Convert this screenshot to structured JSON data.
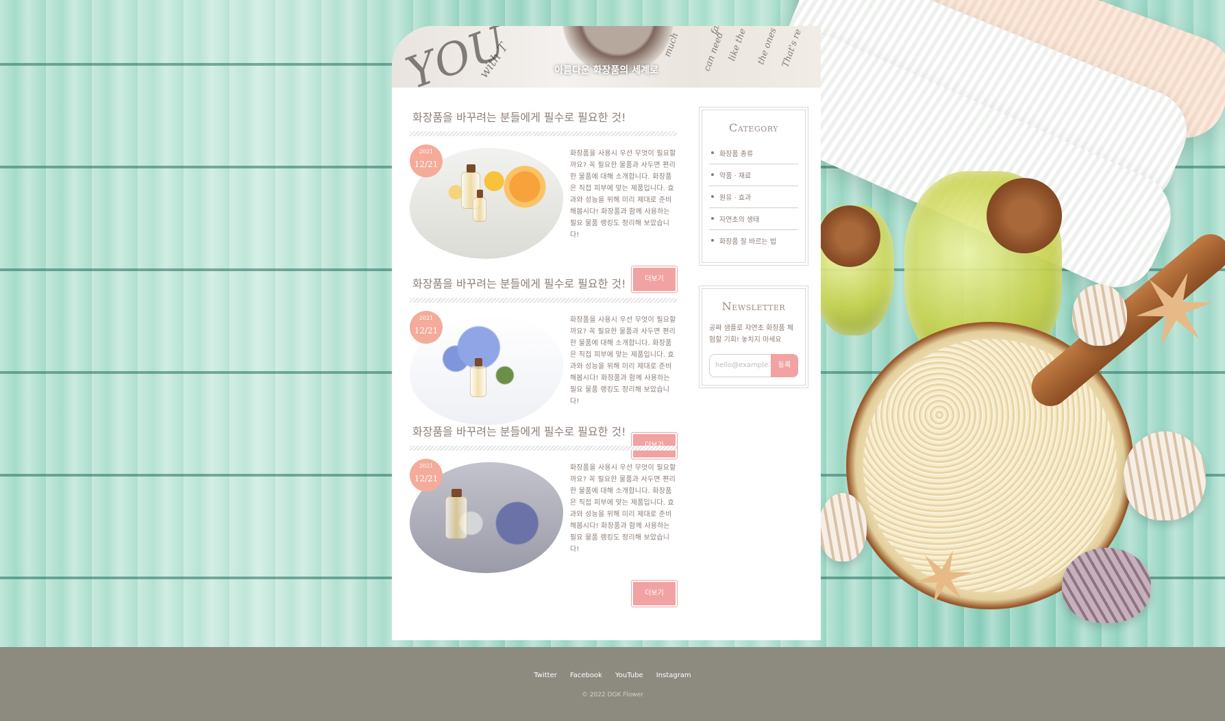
{
  "hero": {
    "title": "아름다운 화장품의 세계로",
    "decor_text": [
      "YOU",
      "with T",
      "can need",
      "like the",
      "the ones w",
      "fasci",
      "That's re",
      "much"
    ]
  },
  "posts": [
    {
      "title": "화장품을 바꾸려는 분들에게 필수로 필요한 것!",
      "date_year": "2021",
      "date_day": "12/21",
      "body": "화장품을 사용시 우선 무엇이 필요할까요? 꼭 필요한 물품과 사두면 편리한 물품에 대해 소개합니다. 화장품은 직접 피부에 맞는 제품입니다. 효과와 성능을 위해 미리 제대로 준비해봅시다! 화장품과 함께 사용하는 필요 물품 랭킹도 정리해 보았습니다!",
      "more": "더보기"
    },
    {
      "title": "화장품을 바꾸려는 분들에게 필수로 필요한 것!",
      "date_year": "2021",
      "date_day": "12/21",
      "body": "화장품을 사용시 우선 무엇이 필요할까요? 꼭 필요한 물품과 사두면 편리한 물품에 대해 소개합니다. 화장품은 직접 피부에 맞는 제품입니다. 효과와 성능을 위해 미리 제대로 준비해봅시다! 화장품과 함께 사용하는 필요 물품 랭킹도 정리해 보았습니다!",
      "more": "더보기"
    },
    {
      "title": "화장품을 바꾸려는 분들에게 필수로 필요한 것!",
      "date_year": "2021",
      "date_day": "12/21",
      "body": "화장품을 사용시 우선 무엇이 필요할까요? 꼭 필요한 물품과 사두면 편리한 물품에 대해 소개합니다. 화장품은 직접 피부에 맞는 제품입니다. 효과와 성능을 위해 미리 제대로 준비해봅시다! 화장품과 함께 사용하는 필요 물품 랭킹도 정리해 보았습니다!",
      "more": "더보기"
    }
  ],
  "sidebar": {
    "category": {
      "title": "Category",
      "items": [
        "화장품 종류",
        "약품 · 재료",
        "원유 · 효과",
        "자연초의 생태",
        "화장품 잘 바르는 법"
      ]
    },
    "newsletter": {
      "title": "Newsletter",
      "description": "공짜 샘플로 자연초 화장품 체험할 기회! 놓치지 마세요",
      "placeholder": "hello@example.com",
      "button": "등록"
    }
  },
  "footer": {
    "links": [
      "Twitter",
      "Facebook",
      "YouTube",
      "Instagram"
    ],
    "copyright": "© 2022 DGK Flower"
  },
  "colors": {
    "accent": "#f1a2a2",
    "badge": "#f4ab99",
    "footer": "#8d8a80",
    "text": "#8b7d76"
  }
}
